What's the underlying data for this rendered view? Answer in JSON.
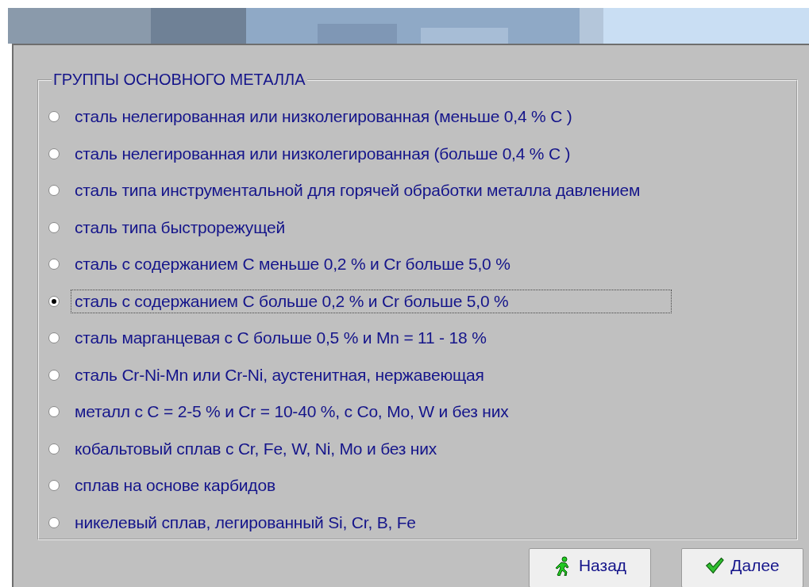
{
  "group": {
    "title": "ГРУППЫ ОСНОВНОГО МЕТАЛЛА",
    "options": [
      {
        "label": "сталь нелегированная или низколегированная (меньше 0,4 % C )",
        "selected": false
      },
      {
        "label": "сталь нелегированная или низколегированная (больше 0,4 % C )",
        "selected": false
      },
      {
        "label": "сталь типа инструментальной для горячей обработки металла давлением",
        "selected": false
      },
      {
        "label": "сталь типа быстрорежущей",
        "selected": false
      },
      {
        "label": "сталь с содержанием C меньше 0,2 % и Cr больше 5,0 %",
        "selected": false
      },
      {
        "label": "сталь с содержанием C больше 0,2 % и Cr больше 5,0 %",
        "selected": true
      },
      {
        "label": "сталь марганцевая с C больше 0,5 % и Mn = 11 - 18 %",
        "selected": false
      },
      {
        "label": "сталь Cr-Ni-Mn или Cr-Ni, аустенитная, нержавеющая",
        "selected": false
      },
      {
        "label": "металл с C = 2-5 % и Cr = 10-40 %, с Co, Mo, W и без них",
        "selected": false
      },
      {
        "label": "кобальтовый сплав с Cr, Fe, W, Ni, Mo и без них",
        "selected": false
      },
      {
        "label": "сплав на основе карбидов",
        "selected": false
      },
      {
        "label": "никелевый сплав, легированный Si, Cr, B, Fe",
        "selected": false
      }
    ]
  },
  "buttons": [
    {
      "kind": "back",
      "label": "Назад"
    },
    {
      "kind": "next",
      "label": "Далее"
    }
  ]
}
